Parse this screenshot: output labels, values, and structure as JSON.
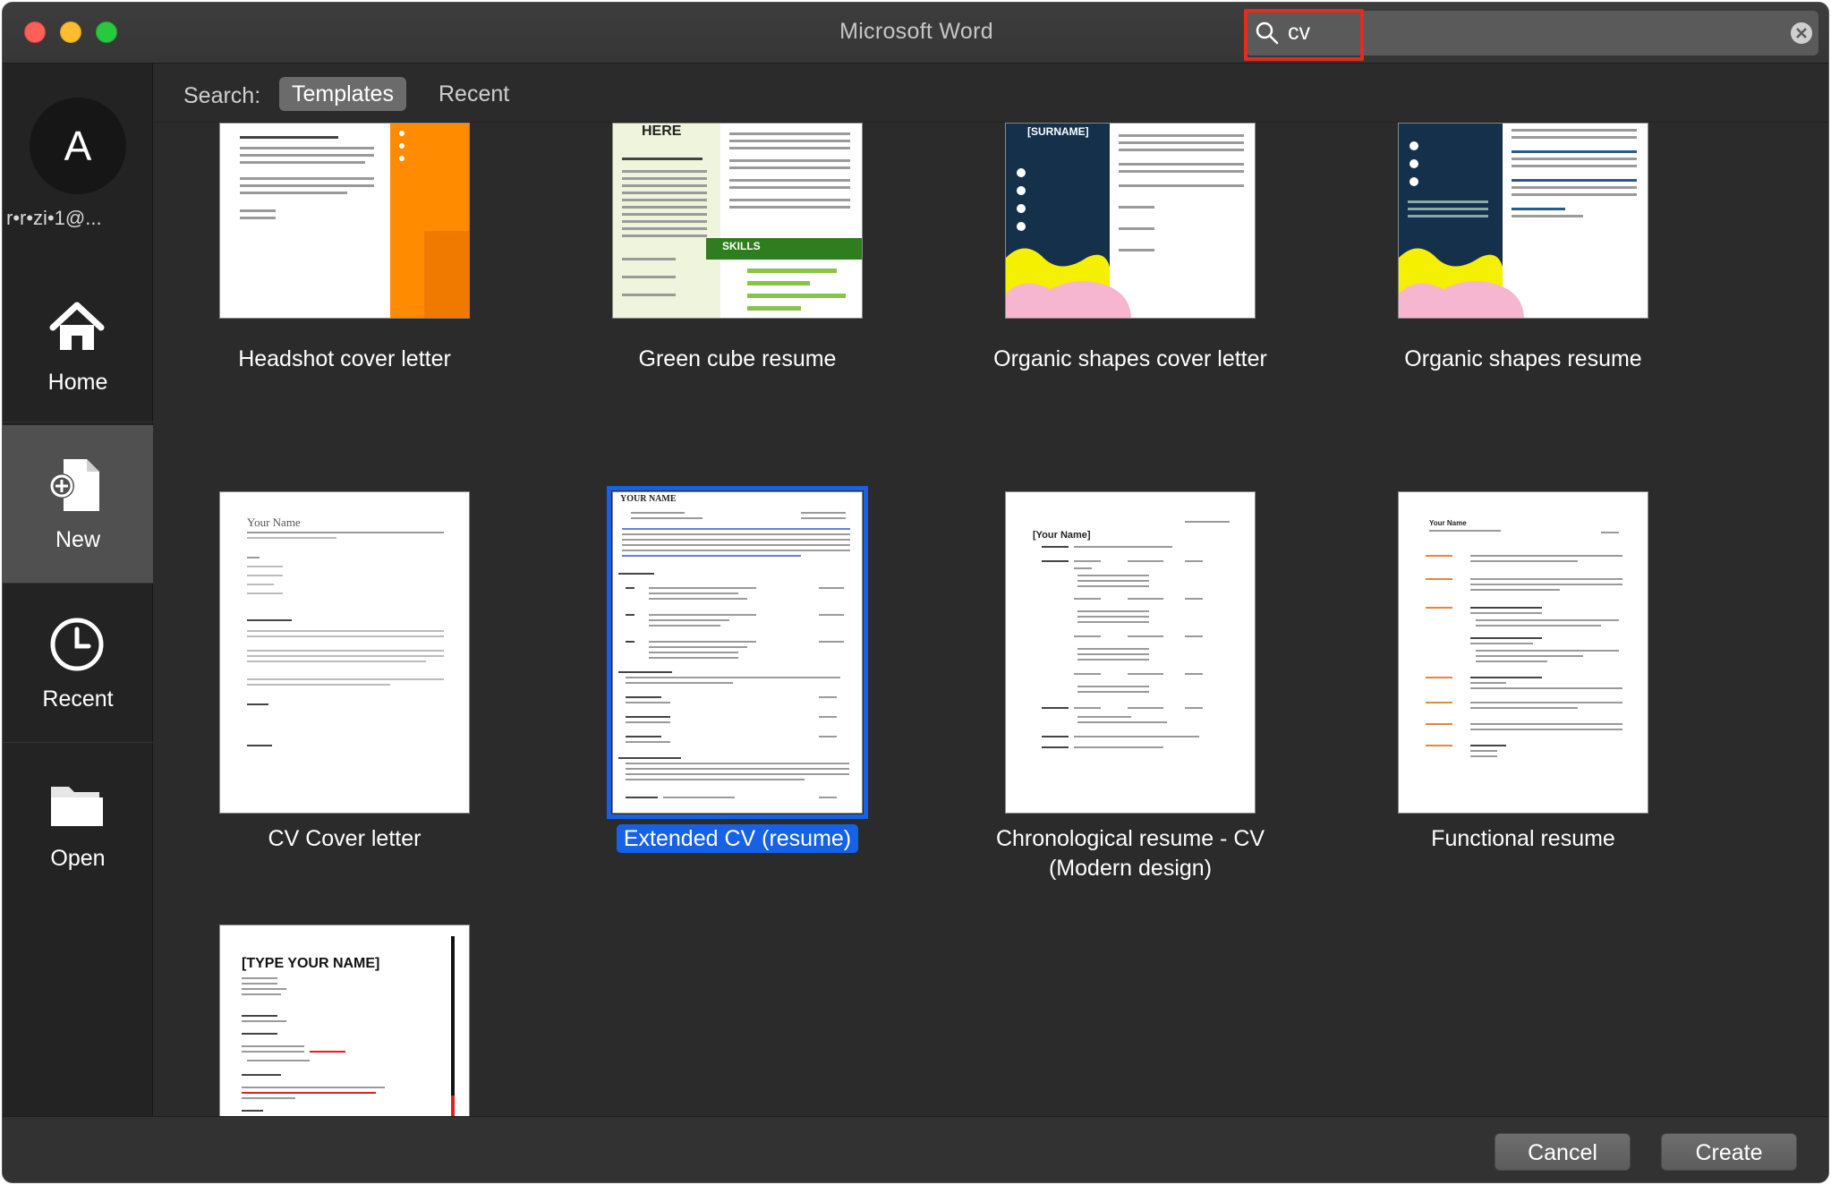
{
  "window": {
    "title": "Microsoft Word"
  },
  "search": {
    "value": "cv",
    "scope_label": "Search:",
    "tabs": [
      {
        "label": "Templates",
        "active": true
      },
      {
        "label": "Recent",
        "active": false
      }
    ]
  },
  "sidebar": {
    "avatar_initial": "A",
    "account_text": "r•r•zi•1@...",
    "items": [
      {
        "label": "Home",
        "icon": "home-icon",
        "active": false
      },
      {
        "label": "New",
        "icon": "new-document-icon",
        "active": true
      },
      {
        "label": "Recent",
        "icon": "clock-icon",
        "active": false
      },
      {
        "label": "Open",
        "icon": "folder-icon",
        "active": false
      }
    ]
  },
  "templates": [
    {
      "name": "Headshot cover letter",
      "selected": false
    },
    {
      "name": "Green cube resume",
      "selected": false,
      "thumb_text": [
        "HERE",
        "SKILLS"
      ]
    },
    {
      "name": "Organic shapes cover letter",
      "selected": false,
      "thumb_text": [
        "[SURNAME]"
      ]
    },
    {
      "name": "Organic shapes resume",
      "selected": false
    },
    {
      "name": "CV Cover letter",
      "selected": false,
      "thumb_text": [
        "Your Name"
      ]
    },
    {
      "name": "Extended CV (resume)",
      "selected": true,
      "thumb_text": [
        "YOUR NAME"
      ]
    },
    {
      "name_line1": "Chronological resume - CV",
      "name_line2": "(Modern design)",
      "selected": false,
      "thumb_text": [
        "[Your Name]"
      ]
    },
    {
      "name": "Functional resume",
      "selected": false,
      "thumb_text": [
        "Your Name"
      ]
    },
    {
      "name": "",
      "selected": false,
      "thumb_text": [
        "[TYPE YOUR NAME]"
      ]
    }
  ],
  "buttons": {
    "cancel": "Cancel",
    "create": "Create"
  },
  "colors": {
    "selection_blue": "#1761e6",
    "search_highlight_red": "#e8291b",
    "orange_accent": "#ff8c00",
    "green_accent": "#2e7d1e",
    "navy_accent": "#14304a"
  }
}
